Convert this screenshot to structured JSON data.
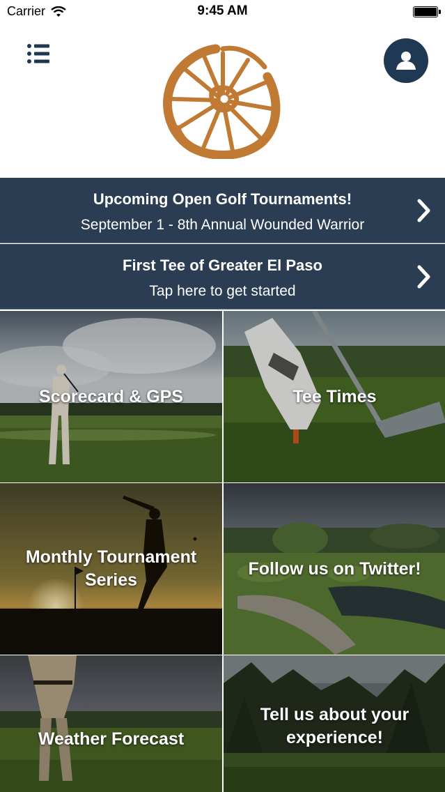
{
  "status_bar": {
    "carrier": "Carrier",
    "time": "9:45 AM",
    "battery_level": 1.0
  },
  "header": {
    "menu_icon": "list-icon",
    "profile_icon": "user-icon",
    "logo": "wagon-wheel-logo",
    "brand_color": "#1f3853",
    "logo_color": "#c07a34"
  },
  "banners": [
    {
      "title": "Upcoming Open Golf Tournaments!",
      "subtitle": "September 1 - 8th Annual Wounded Warrior",
      "icon": "chevron-right-icon"
    },
    {
      "title": "First Tee of Greater El Paso",
      "subtitle": "Tap here to get started",
      "icon": "chevron-right-icon"
    }
  ],
  "banner_color": "#2b3d53",
  "tiles": [
    {
      "label": "Scorecard & GPS"
    },
    {
      "label": "Tee Times"
    },
    {
      "label": "Monthly Tournament\nSeries"
    },
    {
      "label": "Follow us on Twitter!"
    },
    {
      "label": "Weather Forecast"
    },
    {
      "label": "Tell us about your\nexperience!"
    }
  ]
}
